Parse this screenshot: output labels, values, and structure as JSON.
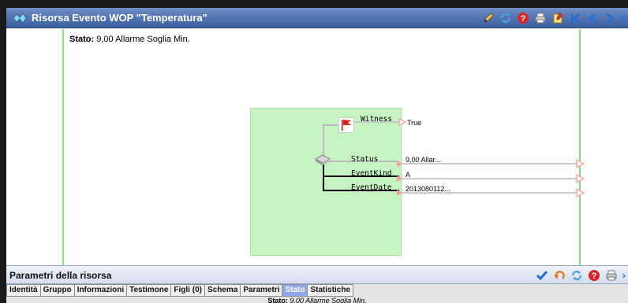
{
  "window": {
    "title": "Risorsa Evento WOP \"Temperatura\"",
    "title_icon": "event-icon"
  },
  "toolbar": {
    "icons": [
      "edit-icon",
      "refresh-icon",
      "help-icon",
      "print-icon",
      "notes-icon",
      "first-icon",
      "prev-icon",
      "next-icon",
      "last-icon"
    ]
  },
  "diagram": {
    "stato_label": "Stato:",
    "stato_value": "9,00 Allarme Soglia Min.",
    "nodes": [
      {
        "name": "Witness",
        "value": "True"
      },
      {
        "name": "Status",
        "value": "9,00 Allar..."
      },
      {
        "name": "EventKind",
        "value": "A"
      },
      {
        "name": "EventDate",
        "value": "2013080112..."
      }
    ],
    "colors": {
      "lane": "#7fe07f",
      "box": "#c7f5c2",
      "arrow": "#f5a0a0"
    }
  },
  "panel": {
    "title": "Parametri della risorsa",
    "icons": [
      "confirm-icon",
      "undo-icon",
      "refresh-icon",
      "help-icon",
      "print-icon"
    ]
  },
  "tabs": [
    {
      "label": "Identità",
      "active": false
    },
    {
      "label": "Gruppo",
      "active": false
    },
    {
      "label": "Informazioni",
      "active": false
    },
    {
      "label": "Testimone",
      "active": false
    },
    {
      "label": "Figli (0)",
      "active": false
    },
    {
      "label": "Schema",
      "active": false
    },
    {
      "label": "Parametri",
      "active": false
    },
    {
      "label": "Stato",
      "active": true
    },
    {
      "label": "Statistiche",
      "active": false
    }
  ],
  "status": {
    "label": "Stato:",
    "value": "9,00 Allarme Soglia Min."
  }
}
